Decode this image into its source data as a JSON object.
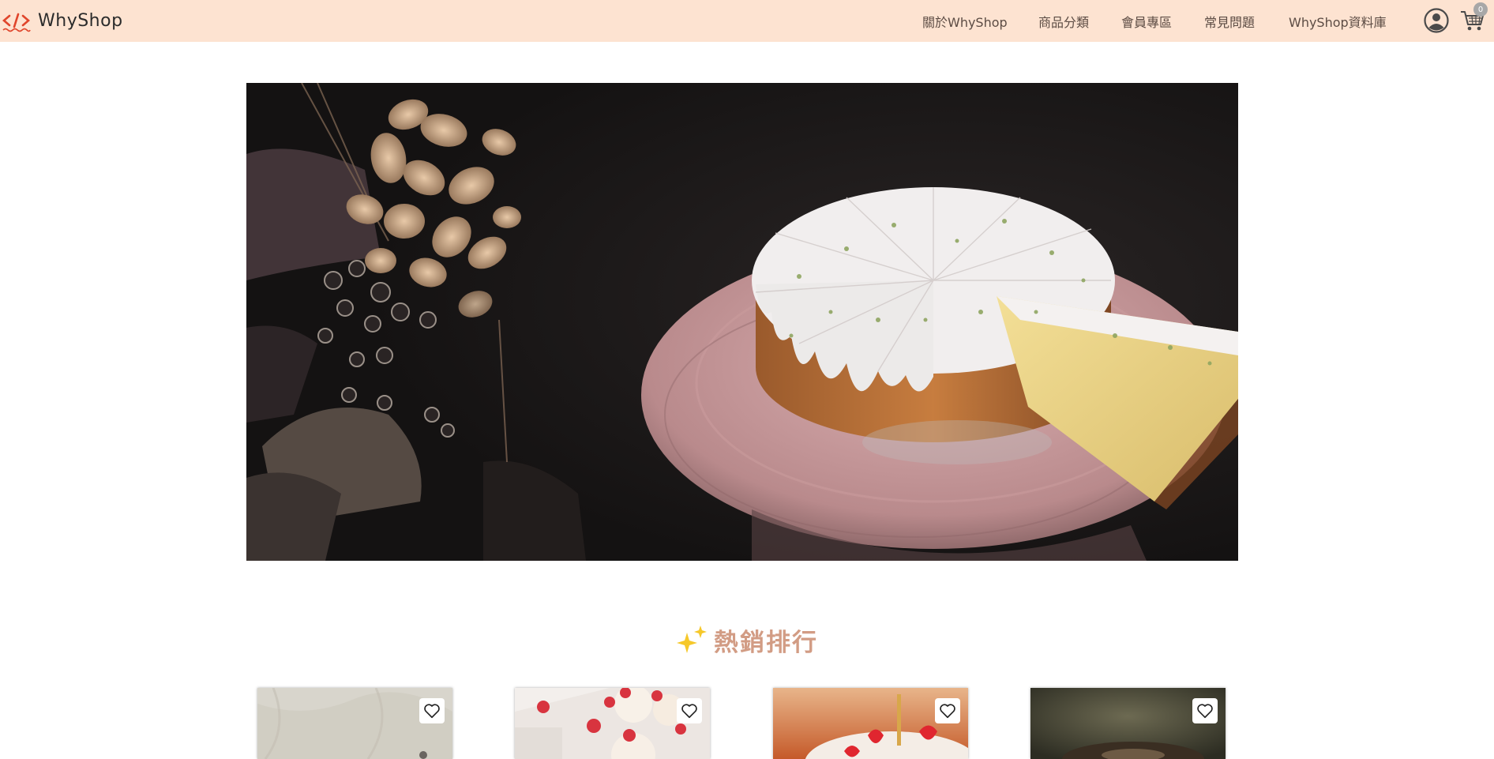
{
  "header": {
    "brand_name": "WhyShop",
    "brand_icon": "code-brackets-logo-icon",
    "nav": [
      {
        "label": "關於WhyShop"
      },
      {
        "label": "商品分類"
      },
      {
        "label": "會員專區"
      },
      {
        "label": "常見問題"
      },
      {
        "label": "WhyShop資料庫"
      }
    ],
    "user_icon": "user-circle-icon",
    "cart_icon": "shopping-cart-icon",
    "cart_count": "0"
  },
  "hero": {
    "image": "sliced-lemon-drizzle-cake-on-pink-stand"
  },
  "bestsellers": {
    "title": "熱銷排行",
    "title_icon": "sparkle-icon",
    "products": [
      {
        "image": "linen-cloth-product-photo",
        "favorite_icon": "heart-outline-icon"
      },
      {
        "image": "raspberry-cupcakes-product-photo",
        "favorite_icon": "heart-outline-icon"
      },
      {
        "image": "strawberry-birthday-cake-product-photo",
        "favorite_icon": "heart-outline-icon"
      },
      {
        "image": "dark-green-product-photo",
        "favorite_icon": "heart-outline-icon"
      }
    ]
  },
  "colors": {
    "header_bg": "#fde3d1",
    "accent_title": "#d29c84",
    "logo_red": "#e0452b",
    "sparkle": "#f6c82a"
  }
}
